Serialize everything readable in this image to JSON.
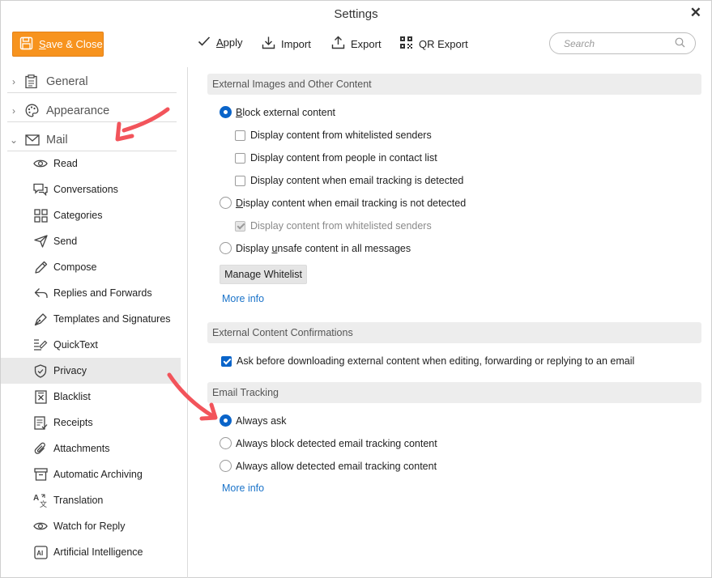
{
  "window": {
    "title": "Settings",
    "close_glyph": "✕"
  },
  "toolbar": {
    "save_close_label": "Save & Close",
    "save_close_prefix": "S",
    "save_close_rest": "ave & Close",
    "apply_label": "Apply",
    "apply_prefix": "A",
    "apply_rest": "pply",
    "import_label": "Import",
    "export_label": "Export",
    "qr_export_label": "QR Export",
    "search_placeholder": "Search",
    "accent_color": "#f7931e"
  },
  "sidebar": {
    "categories": [
      {
        "label": "General",
        "icon": "clipboard-icon",
        "expanded": false
      },
      {
        "label": "Appearance",
        "icon": "palette-icon",
        "expanded": false
      },
      {
        "label": "Mail",
        "icon": "envelope-icon",
        "expanded": true
      }
    ],
    "items": [
      {
        "label": "Read",
        "icon": "eye-icon"
      },
      {
        "label": "Conversations",
        "icon": "chat-bubbles-icon"
      },
      {
        "label": "Categories",
        "icon": "grid-icon"
      },
      {
        "label": "Send",
        "icon": "paper-plane-icon"
      },
      {
        "label": "Compose",
        "icon": "pencil-icon"
      },
      {
        "label": "Replies and Forwards",
        "icon": "reply-icon"
      },
      {
        "label": "Templates and Signatures",
        "icon": "pen-nib-icon"
      },
      {
        "label": "QuickText",
        "icon": "quicktext-icon"
      },
      {
        "label": "Privacy",
        "icon": "shield-icon",
        "active": true
      },
      {
        "label": "Blacklist",
        "icon": "blacklist-icon"
      },
      {
        "label": "Receipts",
        "icon": "receipt-icon"
      },
      {
        "label": "Attachments",
        "icon": "paperclip-icon"
      },
      {
        "label": "Automatic Archiving",
        "icon": "archive-icon"
      },
      {
        "label": "Translation",
        "icon": "translate-icon"
      },
      {
        "label": "Watch for Reply",
        "icon": "eye-icon"
      },
      {
        "label": "Artificial Intelligence",
        "icon": "ai-icon"
      }
    ]
  },
  "content": {
    "external_images": {
      "header": "External Images and Other Content",
      "block_external": {
        "prefix": "B",
        "rest": "lock external content",
        "selected": true
      },
      "whitelisted_senders": {
        "label": "Display content from whitelisted senders",
        "checked": false
      },
      "contact_list": {
        "label": "Display content from people in contact list",
        "checked": false
      },
      "tracking_detected": {
        "label": "Display content when email tracking is detected",
        "checked": false
      },
      "tracking_not_detected": {
        "prefix": "D",
        "rest": "isplay content when email tracking is not detected",
        "selected": false
      },
      "whitelisted_senders_2": {
        "label": "Display content from whitelisted senders",
        "checked": true,
        "disabled": true
      },
      "unsafe_content": {
        "before": "Display ",
        "underlined": "u",
        "after": "nsafe content in all messages",
        "selected": false
      },
      "manage_whitelist_label": "Manage Whitelist",
      "more_info": "More info"
    },
    "confirmations": {
      "header": "External Content Confirmations",
      "ask_before_download": {
        "label": "Ask before downloading external content when editing, forwarding or replying to an email",
        "checked": true
      }
    },
    "email_tracking": {
      "header": "Email Tracking",
      "always_ask": {
        "label": "Always ask",
        "selected": true
      },
      "always_block": {
        "label": "Always block detected email tracking content",
        "selected": false
      },
      "always_allow": {
        "label": "Always allow detected email tracking content",
        "selected": false
      },
      "more_info": "More info"
    }
  },
  "annotations": {
    "arrow_color": "#f2545b"
  }
}
